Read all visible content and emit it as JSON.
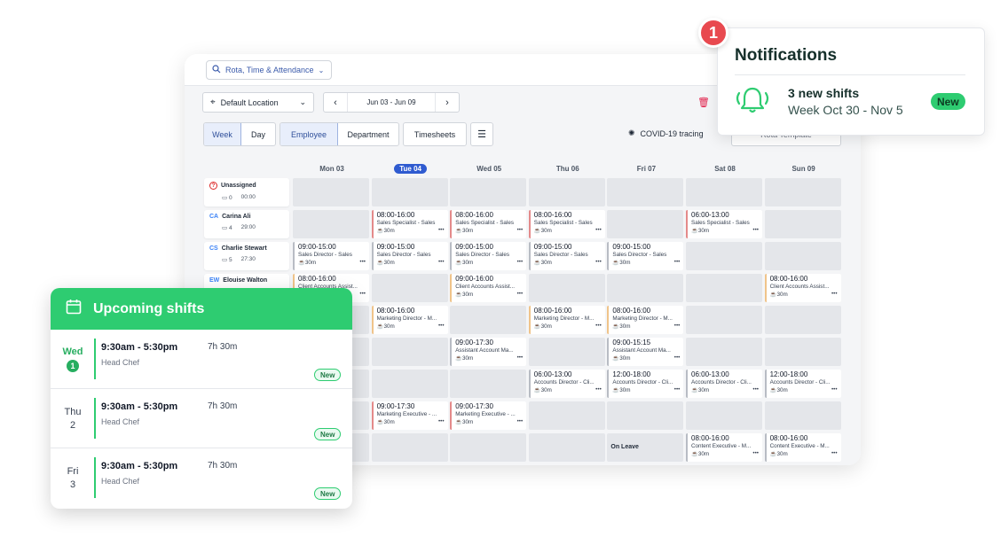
{
  "app": {
    "product_switcher": "Rota, Time & Attendance",
    "location": "Default Location",
    "date_range": "Jun 03 - Jun 09",
    "view_toggle": [
      "Week",
      "Day"
    ],
    "group_toggle": [
      "Employee",
      "Department"
    ],
    "timesheets": "Timesheets",
    "covid": "COVID-19 tracing",
    "rota_template": "Rota Template",
    "days": [
      "Mon 03",
      "Tue 04",
      "Wed 05",
      "Thu 06",
      "Fri 07",
      "Sat 08",
      "Sun 09"
    ],
    "today_index": 1,
    "employees": [
      {
        "name": "Unassigned",
        "initials": "?",
        "count": "0",
        "hours": "00:00"
      },
      {
        "name": "Carina Ali",
        "initials": "CA",
        "count": "4",
        "hours": "29:00"
      },
      {
        "name": "Charlie Stewart",
        "initials": "CS",
        "count": "5",
        "hours": "27:30"
      },
      {
        "name": "Elouise Walton",
        "initials": "EW",
        "count": "",
        "hours": ""
      }
    ],
    "break_label": "30m",
    "more_label": "•••",
    "on_leave": "On Leave"
  },
  "shifts": [
    {
      "t": "08:00-16:00",
      "r": "Sales Specialist - Sales",
      "c": "red"
    },
    {
      "t": "08:00-16:00",
      "r": "Sales Specialist - Sales",
      "c": "red"
    },
    {
      "t": "08:00-16:00",
      "r": "Sales Specialist - Sales",
      "c": "red"
    },
    {
      "t": "06:00-13:00",
      "r": "Sales Specialist - Sales",
      "c": "red"
    },
    {
      "t": "09:00-15:00",
      "r": "Sales Director - Sales",
      "c": "gray"
    },
    {
      "t": "09:00-15:00",
      "r": "Sales Director - Sales",
      "c": "gray"
    },
    {
      "t": "09:00-15:00",
      "r": "Sales Director - Sales",
      "c": "gray"
    },
    {
      "t": "09:00-15:00",
      "r": "Sales Director - Sales",
      "c": "gray"
    },
    {
      "t": "09:00-15:00",
      "r": "Sales Director - Sales",
      "c": "gray"
    },
    {
      "t": "08:00-16:00",
      "r": "Client Accounts Assist...",
      "c": "amber"
    },
    {
      "t": "08:00-16:00",
      "r": "Client Accounts Assist...",
      "c": "amber"
    },
    {
      "t": "09:00-16:00",
      "r": "Client Accounts Assist...",
      "c": "amber"
    },
    {
      "t": "08:00-16:00",
      "r": "Marketing Director - M...",
      "c": "amber"
    },
    {
      "t": "08:00-16:00",
      "r": "Marketing Director - M...",
      "c": "amber"
    },
    {
      "t": "08:00-16:00",
      "r": "Marketing Director - M...",
      "c": "amber"
    },
    {
      "t": "09:00-17:30",
      "r": "Assistant Account Ma...",
      "c": "gray"
    },
    {
      "t": "09:00-15:15",
      "r": "Assistant Account Ma...",
      "c": "gray"
    },
    {
      "t": "06:00-13:00",
      "r": "Accounts Director - Cli...",
      "c": "gray"
    },
    {
      "t": "12:00-18:00",
      "r": "Accounts Director - Cli...",
      "c": "gray"
    },
    {
      "t": "06:00-13:00",
      "r": "Accounts Director - Cli...",
      "c": "gray"
    },
    {
      "t": "12:00-18:00",
      "r": "Accounts Director - Cli...",
      "c": "gray"
    },
    {
      "t": "09:00-17:30",
      "r": "Marketing Executive - ...",
      "c": "red"
    },
    {
      "t": "09:00-17:30",
      "r": "Marketing Executive - ...",
      "c": "red"
    },
    {
      "t": "08:00-16:00",
      "r": "Content Executive - M...",
      "c": "gray"
    },
    {
      "t": "08:00-16:00",
      "r": "Content Executive - M...",
      "c": "gray"
    }
  ],
  "notifications": {
    "badge_count": "1",
    "title": "Notifications",
    "item_title": "3 new shifts",
    "item_sub": "Week Oct 30 - Nov 5",
    "item_badge": "New"
  },
  "upcoming": {
    "title": "Upcoming shifts",
    "rows": [
      {
        "day": "Wed",
        "date": "1",
        "time": "9:30am - 5:30pm",
        "duration": "7h 30m",
        "role": "Head Chef",
        "badge": "New",
        "highlight": true
      },
      {
        "day": "Thu",
        "date": "2",
        "time": "9:30am - 5:30pm",
        "duration": "7h 30m",
        "role": "Head Chef",
        "badge": "New",
        "highlight": false
      },
      {
        "day": "Fri",
        "date": "3",
        "time": "9:30am - 5:30pm",
        "duration": "7h 30m",
        "role": "Head Chef",
        "badge": "New",
        "highlight": false
      }
    ]
  },
  "colors": {
    "brand_green": "#2ecc71",
    "alert_red": "#e8494f",
    "accent_blue": "#2f5bd0"
  }
}
